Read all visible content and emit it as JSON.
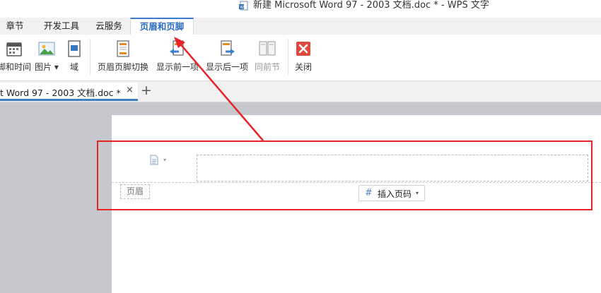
{
  "window": {
    "title": "新建 Microsoft Word 97 - 2003 文档.doc * - WPS 文字"
  },
  "menu_tabs": [
    {
      "label": "章节"
    },
    {
      "label": "开发工具"
    },
    {
      "label": "云服务"
    },
    {
      "label": "页眉和页脚",
      "active": true
    }
  ],
  "ribbon": {
    "items": [
      {
        "label": "脚和时间",
        "icon": "calendar-icon"
      },
      {
        "label": "图片 ▾",
        "icon": "picture-icon"
      },
      {
        "label": "域",
        "icon": "field-icon"
      },
      {
        "label": "页眉页脚切换",
        "icon": "header-footer-switch-icon"
      },
      {
        "label": "显示前一项",
        "icon": "show-previous-icon"
      },
      {
        "label": "显示后一项",
        "icon": "show-next-icon"
      },
      {
        "label": "同前节",
        "icon": "same-as-previous-icon",
        "disabled": true
      },
      {
        "label": "关闭",
        "icon": "close-icon",
        "color": "#e04a3c"
      }
    ]
  },
  "doc_tabs": [
    {
      "label": "t Word 97 - 2003 文档.doc *",
      "close": "×"
    }
  ],
  "new_tab": {
    "label": "+"
  },
  "document": {
    "header_tag": "页眉",
    "insert_page_number": {
      "icon": "#",
      "label": "插入页码",
      "caret": "▾"
    },
    "dropdown_caret": "▾"
  },
  "annotation": {
    "color": "#e8242a"
  }
}
